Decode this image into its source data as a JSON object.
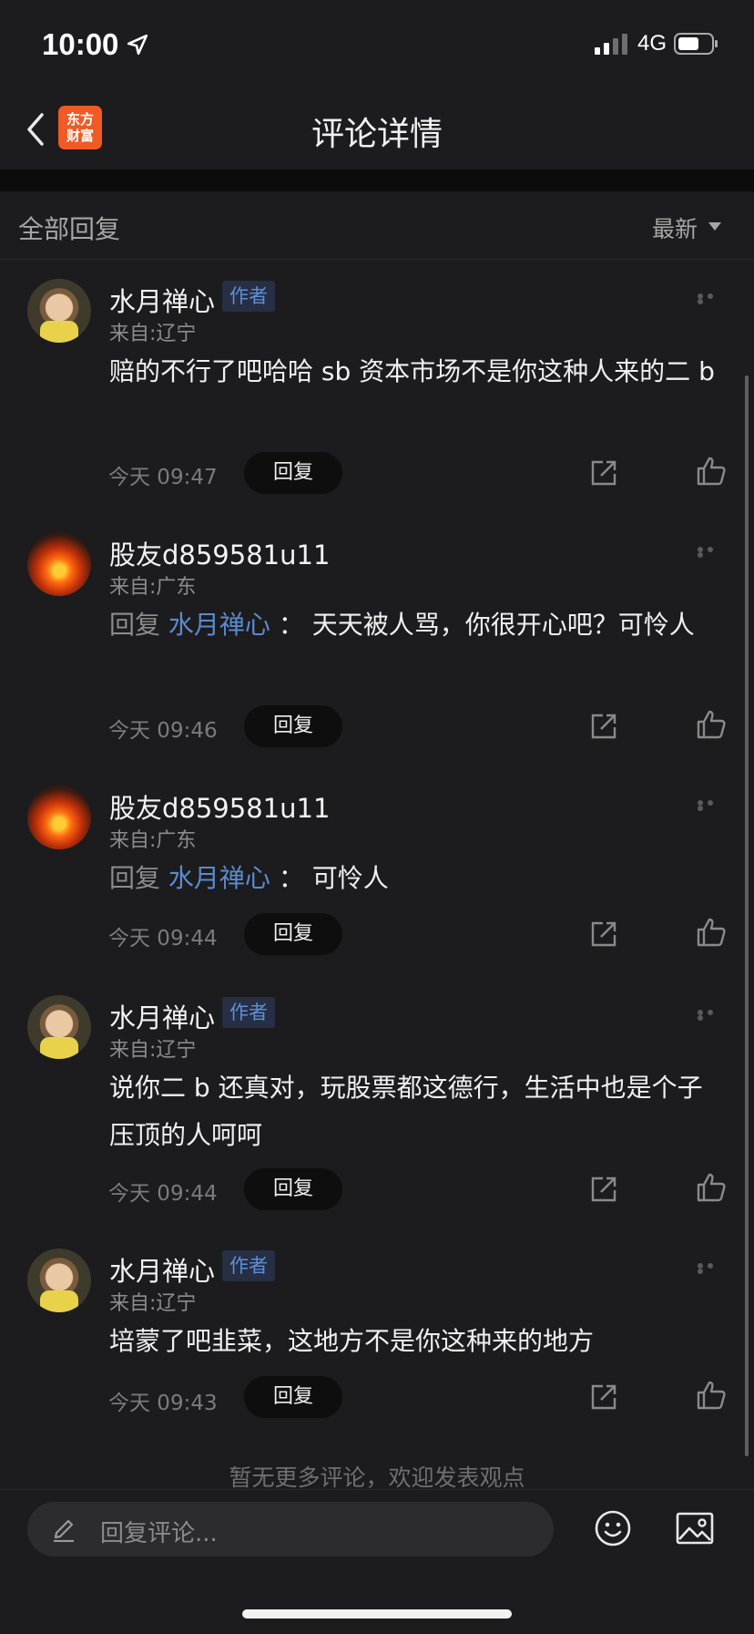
{
  "status": {
    "time": "10:00",
    "network": "4G"
  },
  "nav": {
    "logo_line1": "东方",
    "logo_line2": "财富",
    "title": "评论详情"
  },
  "section": {
    "title": "全部回复",
    "sort": "最新"
  },
  "comments": [
    {
      "name": "水月禅心",
      "badge": "作者",
      "location": "来自:辽宁",
      "text": "赔的不行了吧哈哈 sb 资本市场不是你这种人来的二 b",
      "time": "今天 09:47",
      "reply_button": "回复"
    },
    {
      "name": "股友d859581u11",
      "location": "来自:广东",
      "reply_prefix": "回复",
      "reply_to": "水月禅心",
      "reply_colon": "：",
      "text": "天天被人骂，你很开心吧？可怜人",
      "time": "今天 09:46",
      "reply_button": "回复"
    },
    {
      "name": "股友d859581u11",
      "location": "来自:广东",
      "reply_prefix": "回复",
      "reply_to": "水月禅心",
      "reply_colon": "：",
      "text": "可怜人",
      "time": "今天 09:44",
      "reply_button": "回复"
    },
    {
      "name": "水月禅心",
      "badge": "作者",
      "location": "来自:辽宁",
      "text": "说你二 b 还真对，玩股票都这德行，生活中也是个子压顶的人呵呵",
      "time": "今天 09:44",
      "reply_button": "回复"
    },
    {
      "name": "水月禅心",
      "badge": "作者",
      "location": "来自:辽宁",
      "text": "培蒙了吧韭菜，这地方不是你这种来的地方",
      "time": "今天 09:43",
      "reply_button": "回复"
    }
  ],
  "footer_note": "暂无更多评论，欢迎发表观点",
  "input": {
    "placeholder": "回复评论..."
  },
  "icons": [
    "location-arrow-icon",
    "signal-icon",
    "battery-icon",
    "back-chevron-icon",
    "more-dots-icon",
    "share-icon",
    "thumbs-up-icon",
    "pencil-icon",
    "emoji-icon",
    "image-icon"
  ]
}
